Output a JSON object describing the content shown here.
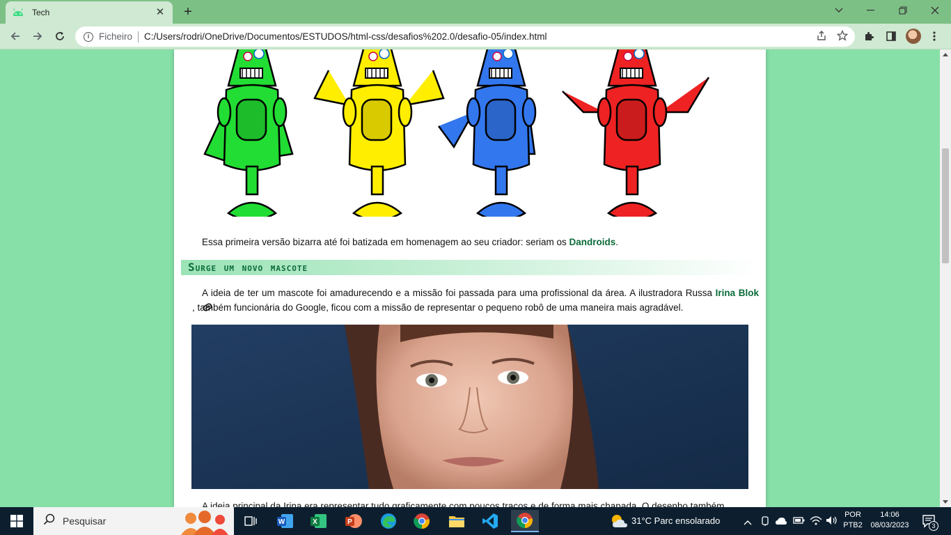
{
  "browser": {
    "tab_title": "Tech",
    "tab_close": "✕",
    "new_tab": "+",
    "address_scheme": "Ficheiro",
    "address_url": "C:/Users/rodri/OneDrive/Documentos/ESTUDOS/html-css/desafios%202.0/desafio-05/index.html"
  },
  "content": {
    "para1_text": "Essa primeira versão bizarra até foi batizada em homenagem ao seu criador: seriam os ",
    "para1_highlight": "Dandroids",
    "para1_end": ".",
    "heading": "Surge um novo mascote",
    "para2_start": "A ideia de ter um mascote foi amadurecendo e a missão foi passada para uma profissional da área. A ilustradora Russa ",
    "para2_link": "Irina Blok",
    "para2_end": ", também funcionária do Google, ficou com a missão de representar o pequeno robô de uma maneira mais agradável.",
    "para3_text": "A ideia principal da Irina era representar tudo graficamente com poucos traços e de forma mais chapada. O desenho também",
    "robot_colors": [
      "#22dd33",
      "#ffee00",
      "#3377ee",
      "#ee2222"
    ]
  },
  "taskbar": {
    "search_label": "Pesquisar",
    "weather": "31°C  Parc ensolarado",
    "lang_line1": "POR",
    "lang_line2": "PTB2",
    "time": "14:06",
    "date": "08/03/2023",
    "notif_count": "3",
    "apps": [
      "task-view",
      "word",
      "excel",
      "powerpoint",
      "edge",
      "chrome",
      "file-explorer",
      "vscode",
      "chrome-active"
    ]
  }
}
